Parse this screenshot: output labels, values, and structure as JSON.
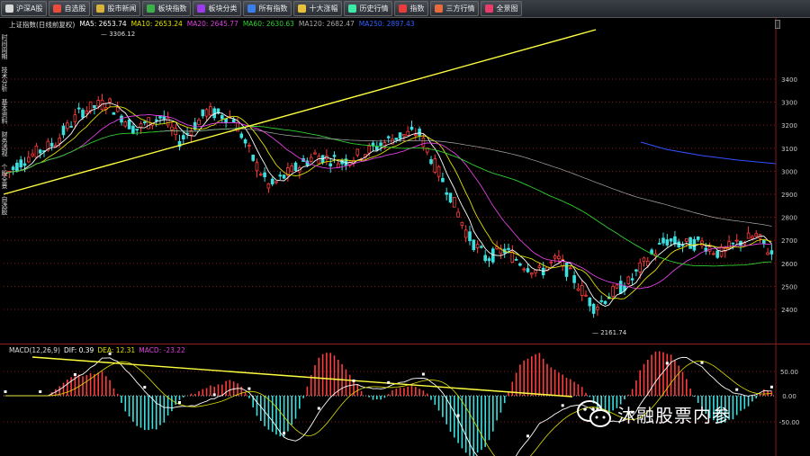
{
  "toolbar": {
    "buttons": [
      {
        "label": "沪深A股",
        "color": "#d9d9d9"
      },
      {
        "label": "自选股",
        "color": "#e94b3c"
      },
      {
        "label": "股市新闻",
        "color": "#d9b23c"
      },
      {
        "label": "板块指数",
        "color": "#3cb04a"
      },
      {
        "label": "板块分类",
        "color": "#9c3ce9"
      },
      {
        "label": "所有指数",
        "color": "#3c7ee9"
      },
      {
        "label": "十大涨幅",
        "color": "#e9c23c"
      },
      {
        "label": "历史行情",
        "color": "#3ce9a6"
      },
      {
        "label": "指数",
        "color": "#e93c3c"
      },
      {
        "label": "三方行情",
        "color": "#e96a3c"
      },
      {
        "label": "全景图",
        "color": "#e93c6a"
      }
    ]
  },
  "price_panel": {
    "title": "上证指数(日线前复权)",
    "legend": [
      {
        "label": "MA5: 2653.74",
        "color": "#ffffff"
      },
      {
        "label": "MA10: 2653.24",
        "color": "#e0e000"
      },
      {
        "label": "MA20: 2645.77",
        "color": "#e040e0"
      },
      {
        "label": "MA60: 2630.63",
        "color": "#30d030"
      },
      {
        "label": "MA120: 2682.47",
        "color": "#aaaaaa"
      },
      {
        "label": "MA250: 2897.43",
        "color": "#3060ff"
      }
    ],
    "side_tabs": [
      "时间周期",
      "技术分析",
      "基本资料",
      "财务透视",
      "个股全景",
      "自选股"
    ],
    "high_label": "3306.12",
    "low_label": "2161.74",
    "axis_labels": [
      "3400",
      "3300",
      "3200",
      "3100",
      "3000",
      "2900",
      "2800",
      "2700",
      "2600",
      "2500",
      "2400"
    ]
  },
  "macd_panel": {
    "title": "MACD(12,26,9)",
    "legend": [
      {
        "label": "DIF: 0.39",
        "color": "#ffffff"
      },
      {
        "label": "DEA: 12.31",
        "color": "#e0e000"
      },
      {
        "label": "MACD: -23.22",
        "color": "#e040e0"
      }
    ],
    "axis_labels": [
      "50.00",
      "0.00",
      "-50.00"
    ]
  },
  "colors": {
    "up": "#ff3c3c",
    "down": "#3ce0e0",
    "trendline": "#ffff40",
    "grid": "#8a1a1a"
  },
  "watermark": {
    "text": "沐融股票内参",
    "icon": "wechat-icon"
  }
}
